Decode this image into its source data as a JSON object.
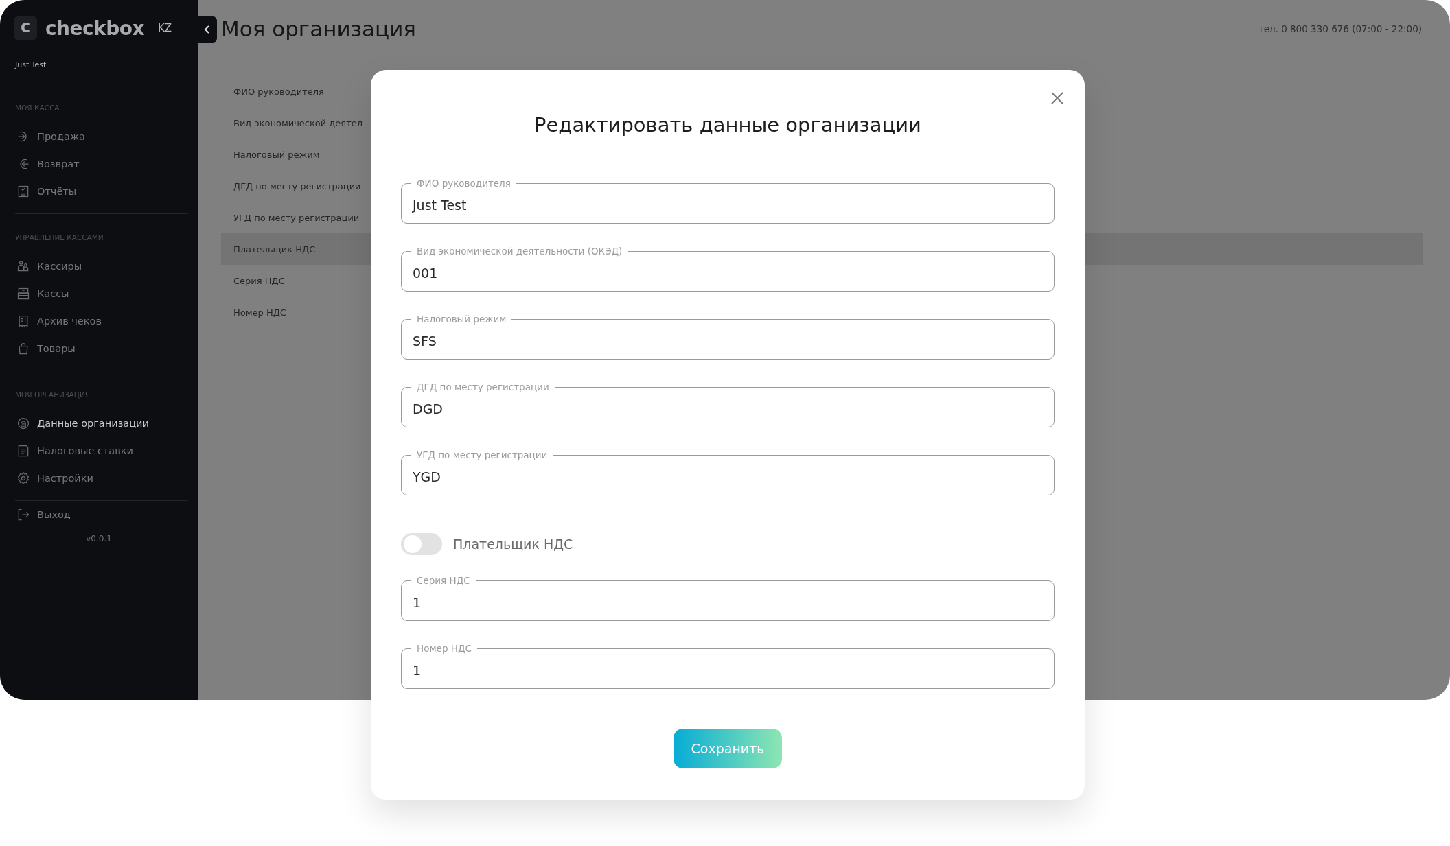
{
  "app": {
    "logo_letter": "c",
    "logo": "checkbox",
    "locale": "KZ",
    "user": "Just Test",
    "version": "v0.0.1"
  },
  "sidebar": {
    "sections": [
      {
        "heading": "МОЯ КАССА",
        "items": [
          {
            "label": "Продажа",
            "selected": false
          },
          {
            "label": "Возврат",
            "selected": false
          },
          {
            "label": "Отчёты",
            "selected": false
          }
        ]
      },
      {
        "heading": "УПРАВЛЕНИЕ КАССАМИ",
        "items": [
          {
            "label": "Кассиры",
            "selected": false
          },
          {
            "label": "Кассы",
            "selected": false
          },
          {
            "label": "Архив чеков",
            "selected": false
          },
          {
            "label": "Товары",
            "selected": false
          }
        ]
      },
      {
        "heading": "МОЯ ОРГАНИЗАЦИЯ",
        "items": [
          {
            "label": "Данные организации",
            "selected": true
          },
          {
            "label": "Налоговые ставки",
            "selected": false
          },
          {
            "label": "Настройки",
            "selected": false
          }
        ]
      }
    ],
    "logout": "Выход"
  },
  "header": {
    "title": "Моя организация",
    "phone": "тел. 0 800 330 676 (07:00 - 22:00)"
  },
  "details": {
    "rows": [
      {
        "label": "ФИО руководителя",
        "selected": false
      },
      {
        "label": "Вид экономической деятел",
        "selected": false
      },
      {
        "label": "Налоговый режим",
        "selected": false
      },
      {
        "label": "ДГД по месту регистрации",
        "selected": false
      },
      {
        "label": "УГД по месту регистрации",
        "selected": false
      },
      {
        "label": "Плательщик НДС",
        "selected": true
      },
      {
        "label": "Серия НДС",
        "selected": false
      },
      {
        "label": "Номер НДС",
        "selected": false
      }
    ]
  },
  "modal": {
    "title": "Редактировать данные организации",
    "items": [
      {
        "kind": "field",
        "label": "ФИО руководителя",
        "value": "Just Test"
      },
      {
        "kind": "field",
        "label": "Вид экономической деятельности (ОКЭД)",
        "value": "001"
      },
      {
        "kind": "field",
        "label": "Налоговый режим",
        "value": "SFS"
      },
      {
        "kind": "field",
        "label": "ДГД по месту регистрации",
        "value": "DGD"
      },
      {
        "kind": "field",
        "label": "УГД по месту регистрации",
        "value": "YGD"
      },
      {
        "kind": "toggle",
        "label": "Плательщик НДС",
        "on": false
      },
      {
        "kind": "field",
        "label": "Серия НДС",
        "value": "1"
      },
      {
        "kind": "field",
        "label": "Номер НДС",
        "value": "1"
      }
    ],
    "save_button": "Сохранить"
  }
}
